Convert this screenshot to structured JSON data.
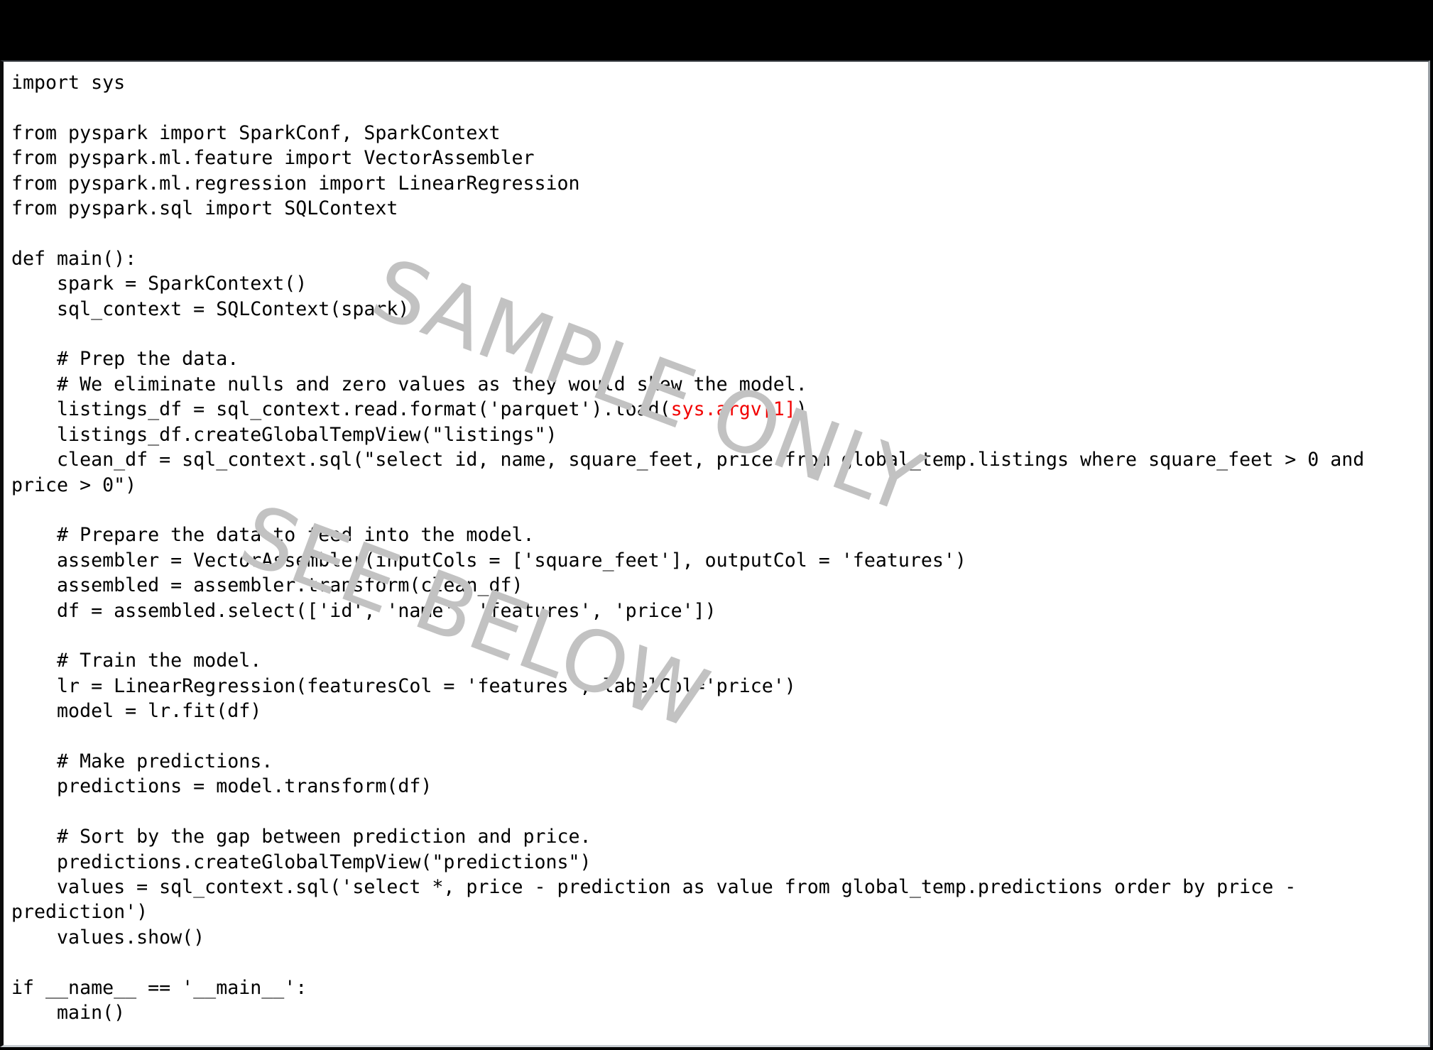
{
  "window": {
    "background_color": "#000000",
    "panel_background_color": "#ffffff",
    "text_color": "#000000",
    "accent_color": "#f20000",
    "watermark_color": "#c2c2c2"
  },
  "watermark": {
    "line1": "SAMPLE ONLY",
    "line2": "SEE BELOW"
  },
  "code": {
    "language": "python",
    "lines": [
      "import sys",
      "",
      "from pyspark import SparkConf, SparkContext",
      "from pyspark.ml.feature import VectorAssembler",
      "from pyspark.ml.regression import LinearRegression",
      "from pyspark.sql import SQLContext",
      "",
      "def main():",
      "    spark = SparkContext()",
      "    sql_context = SQLContext(spark)",
      "",
      "    # Prep the data.",
      "    # We eliminate nulls and zero values as they would skew the model.",
      "    listings_df = sql_context.read.format('parquet').load(sys.argv[1])",
      "    listings_df.createGlobalTempView(\"listings\")",
      "    clean_df = sql_context.sql(\"select id, name, square_feet, price from global_temp.listings where square_feet > 0 and price > 0\")",
      "",
      "    # Prepare the data to feed into the model.",
      "    assembler = VectorAssembler(inputCols = ['square_feet'], outputCol = 'features')",
      "    assembled = assembler.transform(clean_df)",
      "    df = assembled.select(['id', 'name', 'features', 'price'])",
      "",
      "    # Train the model.",
      "    lr = LinearRegression(featuresCol = 'features', labelCol='price')",
      "    model = lr.fit(df)",
      "",
      "    # Make predictions.",
      "    predictions = model.transform(df)",
      "",
      "    # Sort by the gap between prediction and price.",
      "    predictions.createGlobalTempView(\"predictions\")",
      "    values = sql_context.sql('select *, price - prediction as value from global_temp.predictions order by price - prediction')",
      "    values.show()",
      "",
      "if __name__ == '__main__':",
      "    main()"
    ],
    "segments": [
      {
        "id": "seg-01",
        "text": "import sys\n"
      },
      {
        "id": "seg-02",
        "text": "\n"
      },
      {
        "id": "seg-03",
        "text": "from pyspark import SparkConf, SparkContext\n"
      },
      {
        "id": "seg-04",
        "text": "from pyspark.ml.feature import VectorAssembler\n"
      },
      {
        "id": "seg-05",
        "text": "from pyspark.ml.regression import LinearRegression\n"
      },
      {
        "id": "seg-06",
        "text": "from pyspark.sql import SQLContext\n"
      },
      {
        "id": "seg-07",
        "text": "\n"
      },
      {
        "id": "seg-08",
        "text": "def main():\n"
      },
      {
        "id": "seg-09",
        "text": "    spark = SparkContext()\n"
      },
      {
        "id": "seg-10",
        "text": "    sql_context = SQLContext(spark)\n"
      },
      {
        "id": "seg-11",
        "text": "\n"
      },
      {
        "id": "seg-12",
        "text": "    # Prep the data.\n"
      },
      {
        "id": "seg-13",
        "text": "    # We eliminate nulls and zero values as they would skew the model.\n"
      },
      {
        "id": "seg-14a",
        "text": "    listings_df = sql_context.read.format('parquet').load("
      },
      {
        "id": "seg-14b",
        "text": "sys.argv[1]",
        "accent": true
      },
      {
        "id": "seg-14c",
        "text": ")\n"
      },
      {
        "id": "seg-15",
        "text": "    listings_df.createGlobalTempView(\"listings\")\n"
      },
      {
        "id": "seg-16",
        "text": "    clean_df = sql_context.sql(\"select id, name, square_feet, price from global_temp.listings where square_feet > 0 and price > 0\")\n"
      },
      {
        "id": "seg-17",
        "text": "\n"
      },
      {
        "id": "seg-18",
        "text": "    # Prepare the data to feed into the model.\n"
      },
      {
        "id": "seg-19",
        "text": "    assembler = VectorAssembler(inputCols = ['square_feet'], outputCol = 'features')\n"
      },
      {
        "id": "seg-20",
        "text": "    assembled = assembler.transform(clean_df)\n"
      },
      {
        "id": "seg-21",
        "text": "    df = assembled.select(['id', 'name', 'features', 'price'])\n"
      },
      {
        "id": "seg-22",
        "text": "\n"
      },
      {
        "id": "seg-23",
        "text": "    # Train the model.\n"
      },
      {
        "id": "seg-24",
        "text": "    lr = LinearRegression(featuresCol = 'features', labelCol='price')\n"
      },
      {
        "id": "seg-25",
        "text": "    model = lr.fit(df)\n"
      },
      {
        "id": "seg-26",
        "text": "\n"
      },
      {
        "id": "seg-27",
        "text": "    # Make predictions.\n"
      },
      {
        "id": "seg-28",
        "text": "    predictions = model.transform(df)\n"
      },
      {
        "id": "seg-29",
        "text": "\n"
      },
      {
        "id": "seg-30",
        "text": "    # Sort by the gap between prediction and price.\n"
      },
      {
        "id": "seg-31",
        "text": "    predictions.createGlobalTempView(\"predictions\")\n"
      },
      {
        "id": "seg-32",
        "text": "    values = sql_context.sql('select *, price - prediction as value from global_temp.predictions order by price - prediction')\n"
      },
      {
        "id": "seg-33",
        "text": "    values.show()\n"
      },
      {
        "id": "seg-34",
        "text": "\n"
      },
      {
        "id": "seg-35",
        "text": "if __name__ == '__main__':\n"
      },
      {
        "id": "seg-36",
        "text": "    main()"
      }
    ]
  }
}
